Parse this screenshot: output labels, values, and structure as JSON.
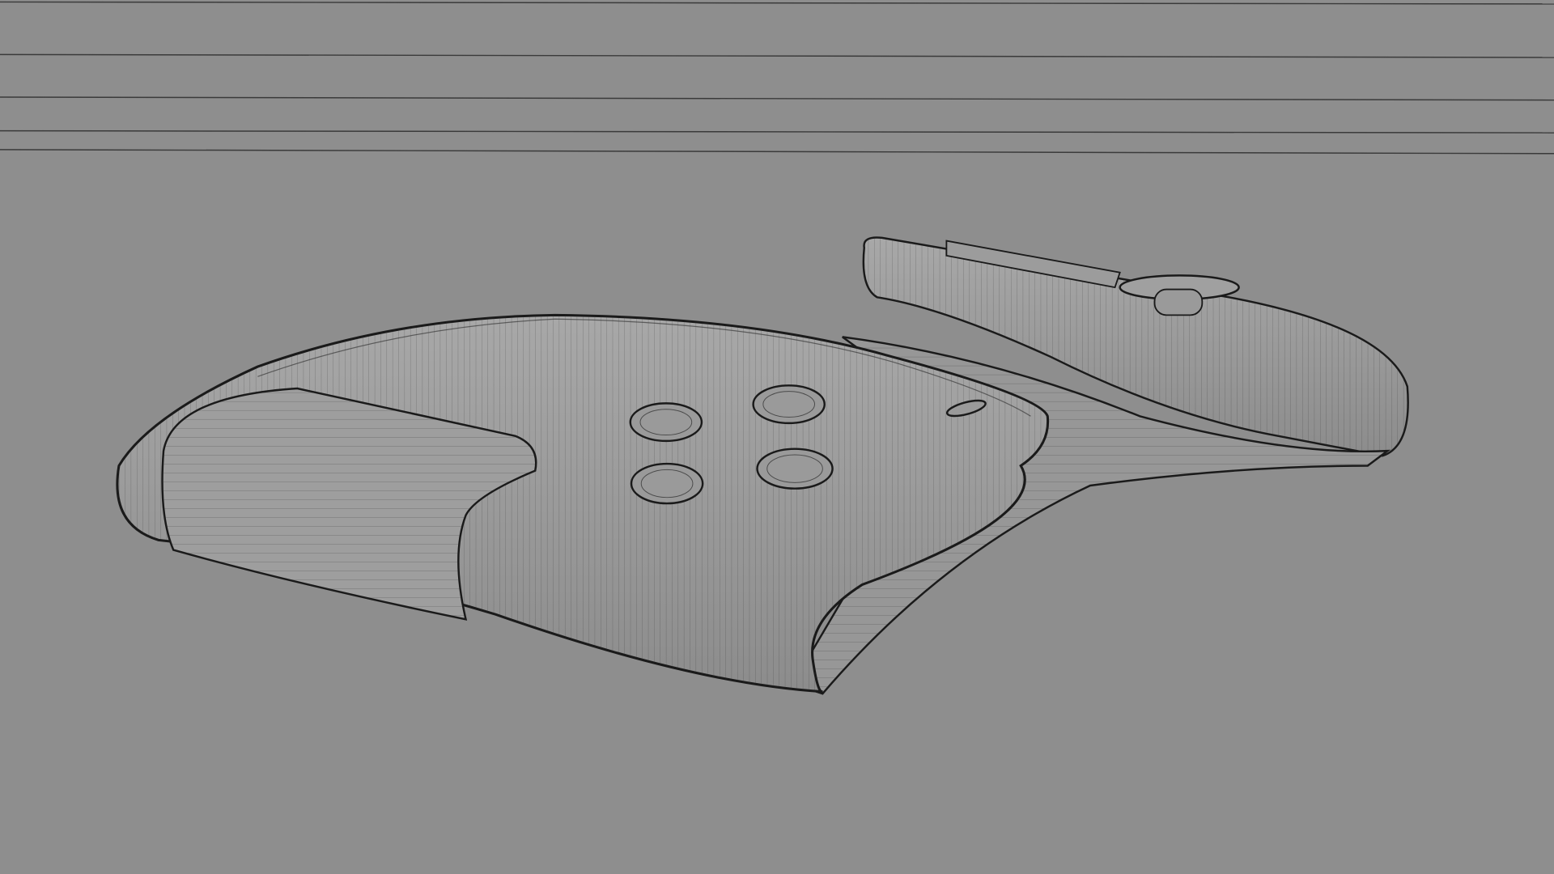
{
  "viewport": {
    "background_color": "#8e8e8e",
    "surface_color": "#9a9a9a",
    "highlight_color": "#a6a6a6",
    "wire_color": "#2a2a2a",
    "outline_color": "#1a1a1a"
  }
}
